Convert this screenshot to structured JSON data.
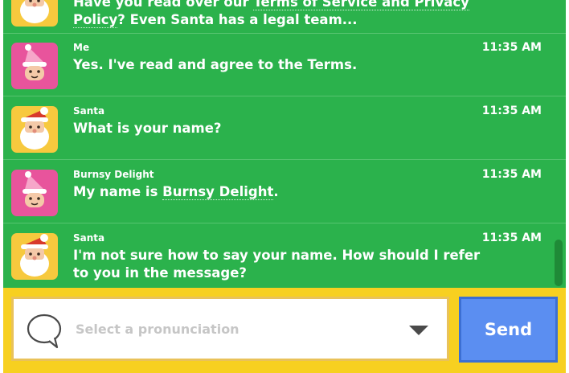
{
  "messages": [
    {
      "sender": "",
      "avatar": "santa",
      "time": "",
      "text_a": "Have you read over our ",
      "text_link": "Terms of Service and Privacy Policy",
      "text_b": "? Even Santa has a legal team..."
    },
    {
      "sender": "Me",
      "avatar": "elf",
      "time": "11:35 AM",
      "text": "Yes. I've read and agree to the Terms."
    },
    {
      "sender": "Santa",
      "avatar": "santa",
      "time": "11:35 AM",
      "text": "What is your name?"
    },
    {
      "sender": "Burnsy Delight",
      "avatar": "elf",
      "time": "11:35 AM",
      "text_a": "My name is ",
      "text_link": "Burnsy Delight",
      "text_b": "."
    },
    {
      "sender": "Santa",
      "avatar": "santa",
      "time": "11:35 AM",
      "text": "I'm not sure how to say your name. How should I refer to you in the message?"
    }
  ],
  "composer": {
    "placeholder": "Select a pronunciation",
    "send_label": "Send",
    "icons": {
      "bubble": "speech-bubble-icon",
      "caret": "caret-down-icon"
    }
  },
  "colors": {
    "chat_background": "#2bb24c",
    "footer_background": "#f7d020",
    "send_button": "#5b8ef1",
    "santa_avatar_bg": "#f7c93e",
    "elf_avatar_bg": "#e8549c"
  }
}
